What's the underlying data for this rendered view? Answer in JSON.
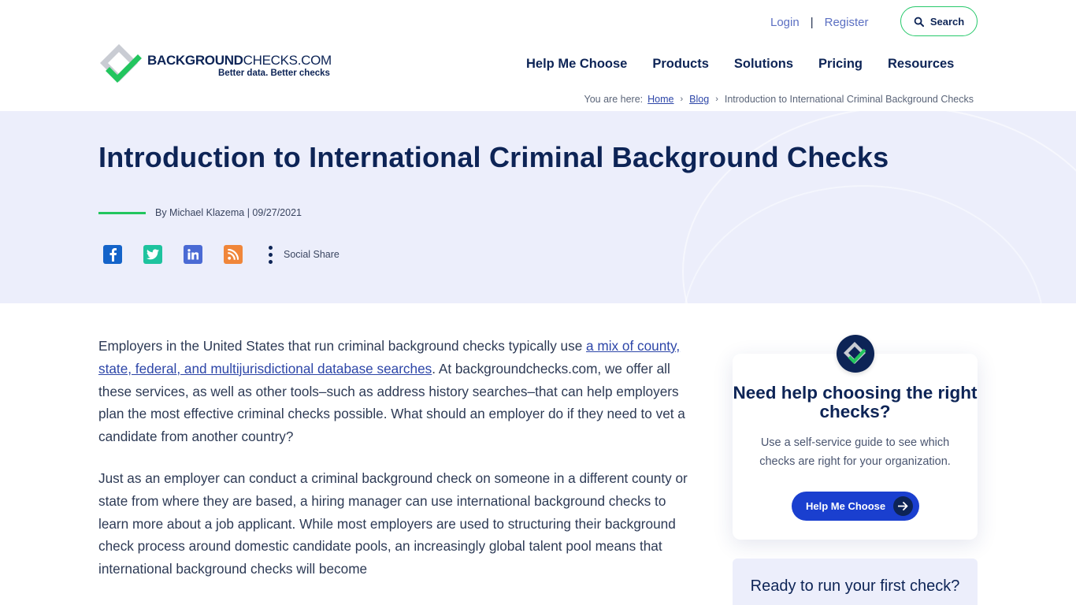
{
  "header": {
    "logo": {
      "word_bold": "BACKGROUND",
      "word_rest": "CHECKS.COM",
      "tag_a": "Better data.",
      "tag_b": "Better checks"
    },
    "top_links": {
      "login": "Login",
      "separator": "|",
      "register": "Register"
    },
    "search_label": "Search",
    "nav": [
      "Help Me Choose",
      "Products",
      "Solutions",
      "Pricing",
      "Resources"
    ],
    "breadcrumb": {
      "prefix": "You are here:",
      "home": "Home",
      "blog": "Blog",
      "current": "Introduction to International Criminal Background Checks",
      "chevron": "›"
    }
  },
  "hero": {
    "title": "Introduction to International Criminal Background Checks",
    "byline": "By Michael Klazema | 09/27/2021",
    "social_label": "Social Share",
    "social_icons": [
      "facebook-icon",
      "twitter-icon",
      "linkedin-icon",
      "rss-icon",
      "more-vertical-icon"
    ]
  },
  "article": {
    "p1_before": "Employers in the United States that run criminal background checks typically use ",
    "p1_link": "a mix of county, state, federal, and multijurisdictional database searches",
    "p1_after": ". At backgroundchecks.com, we offer all these services, as well as other tools–such as address history searches–that can help employers plan the most effective criminal checks possible. What should an employer do if they need to vet a candidate from another country?",
    "p2": "Just as an employer can conduct a criminal background check on someone in a different county or state from where they are based, a hiring manager can use international background checks to learn more about a job applicant. While most employers are used to structuring their background check process around domestic candidate pools, an increasingly global talent pool means that international background checks will become"
  },
  "sidebar": {
    "help": {
      "title": "Need help choosing the right checks?",
      "text": "Use a self-service guide to see which checks are right for your organization.",
      "button": "Help Me Choose"
    },
    "ready": {
      "title": "Ready to run your first check?"
    }
  },
  "colors": {
    "navy": "#0d2456",
    "accent_green": "#22c55e",
    "button_blue": "#1a3fcf",
    "hero_bg": "#eceefb",
    "link": "#2d46a8"
  }
}
